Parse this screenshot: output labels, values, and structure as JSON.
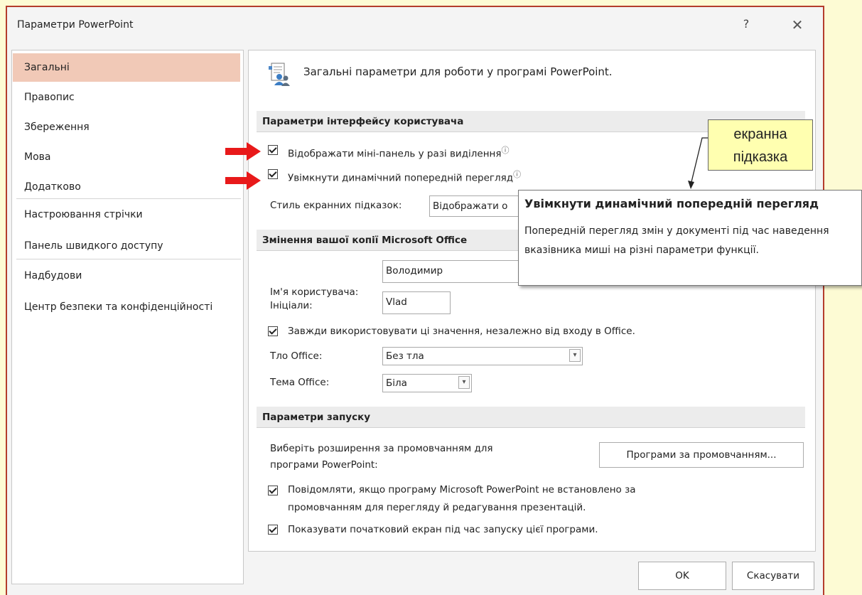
{
  "window": {
    "title": "Параметри PowerPoint",
    "help_symbol": "?",
    "close_symbol": "✕"
  },
  "sidebar": {
    "items": [
      {
        "label": "Загальні",
        "selected": true
      },
      {
        "label": "Правопис"
      },
      {
        "label": "Збереження"
      },
      {
        "label": "Мова"
      },
      {
        "label": "Додатково"
      },
      {
        "label": "Настроювання стрічки"
      },
      {
        "label": "Панель швидкого доступу"
      },
      {
        "label": "Надбудови"
      },
      {
        "label": "Центр безпеки та конфіденційності"
      }
    ]
  },
  "main": {
    "header": "Загальні параметри для роботи у програмі PowerPoint.",
    "header_icon": "general-settings-icon",
    "ui_section": {
      "title": "Параметри інтерфейсу користувача",
      "mini_toolbar": {
        "label": "Відображати міні-панель у разі виділення",
        "checked": true
      },
      "live_preview": {
        "label": "Увімкнути динамічний попередній перегляд",
        "checked": true
      },
      "screentip_label": "Стиль екранних підказок:",
      "screentip_value": "Відображати о"
    },
    "office_section": {
      "title": "Змінення вашої копії Microsoft Office",
      "username_label": "Ім'я користувача:",
      "username_value": "Володимир",
      "initials_label": "Ініціали:",
      "initials_value": "Vlad",
      "always_use": {
        "label": "Завжди використовувати ці значення, незалежно від входу в Office.",
        "checked": true
      },
      "background_label": "Тло Office:",
      "background_value": "Без тла",
      "theme_label": "Тема Office:",
      "theme_value": "Біла"
    },
    "startup_section": {
      "title": "Параметри запуску",
      "extensions_line1": "Виберіть розширення за промовчанням для",
      "extensions_line2": "програми PowerPoint:",
      "defaults_button": "Програми за промовчанням...",
      "notify_line1": "Повідомляти, якщо програму Microsoft PowerPoint не встановлено за",
      "notify_line2": "промовчанням для перегляду й редагування презентацій.",
      "notify_checked": true,
      "start_screen": {
        "label": "Показувати початковий екран під час запуску цієї програми.",
        "checked": true
      }
    }
  },
  "footer": {
    "ok": "OK",
    "cancel": "Скасувати"
  },
  "tooltip": {
    "title": "Увімкнути динамічний попередній перегляд",
    "body": "Попередній перегляд змін у документі під час наведення вказівника миші на різні параметри функції."
  },
  "callout": {
    "line1": "екранна",
    "line2": "підказка"
  },
  "colors": {
    "selected_nav": "#f1c9b7",
    "page_background": "#fdfbd4",
    "dialog_border": "#b43c2c",
    "annotation_arrow": "#e8191a",
    "callout_fill": "#ffffb0"
  }
}
